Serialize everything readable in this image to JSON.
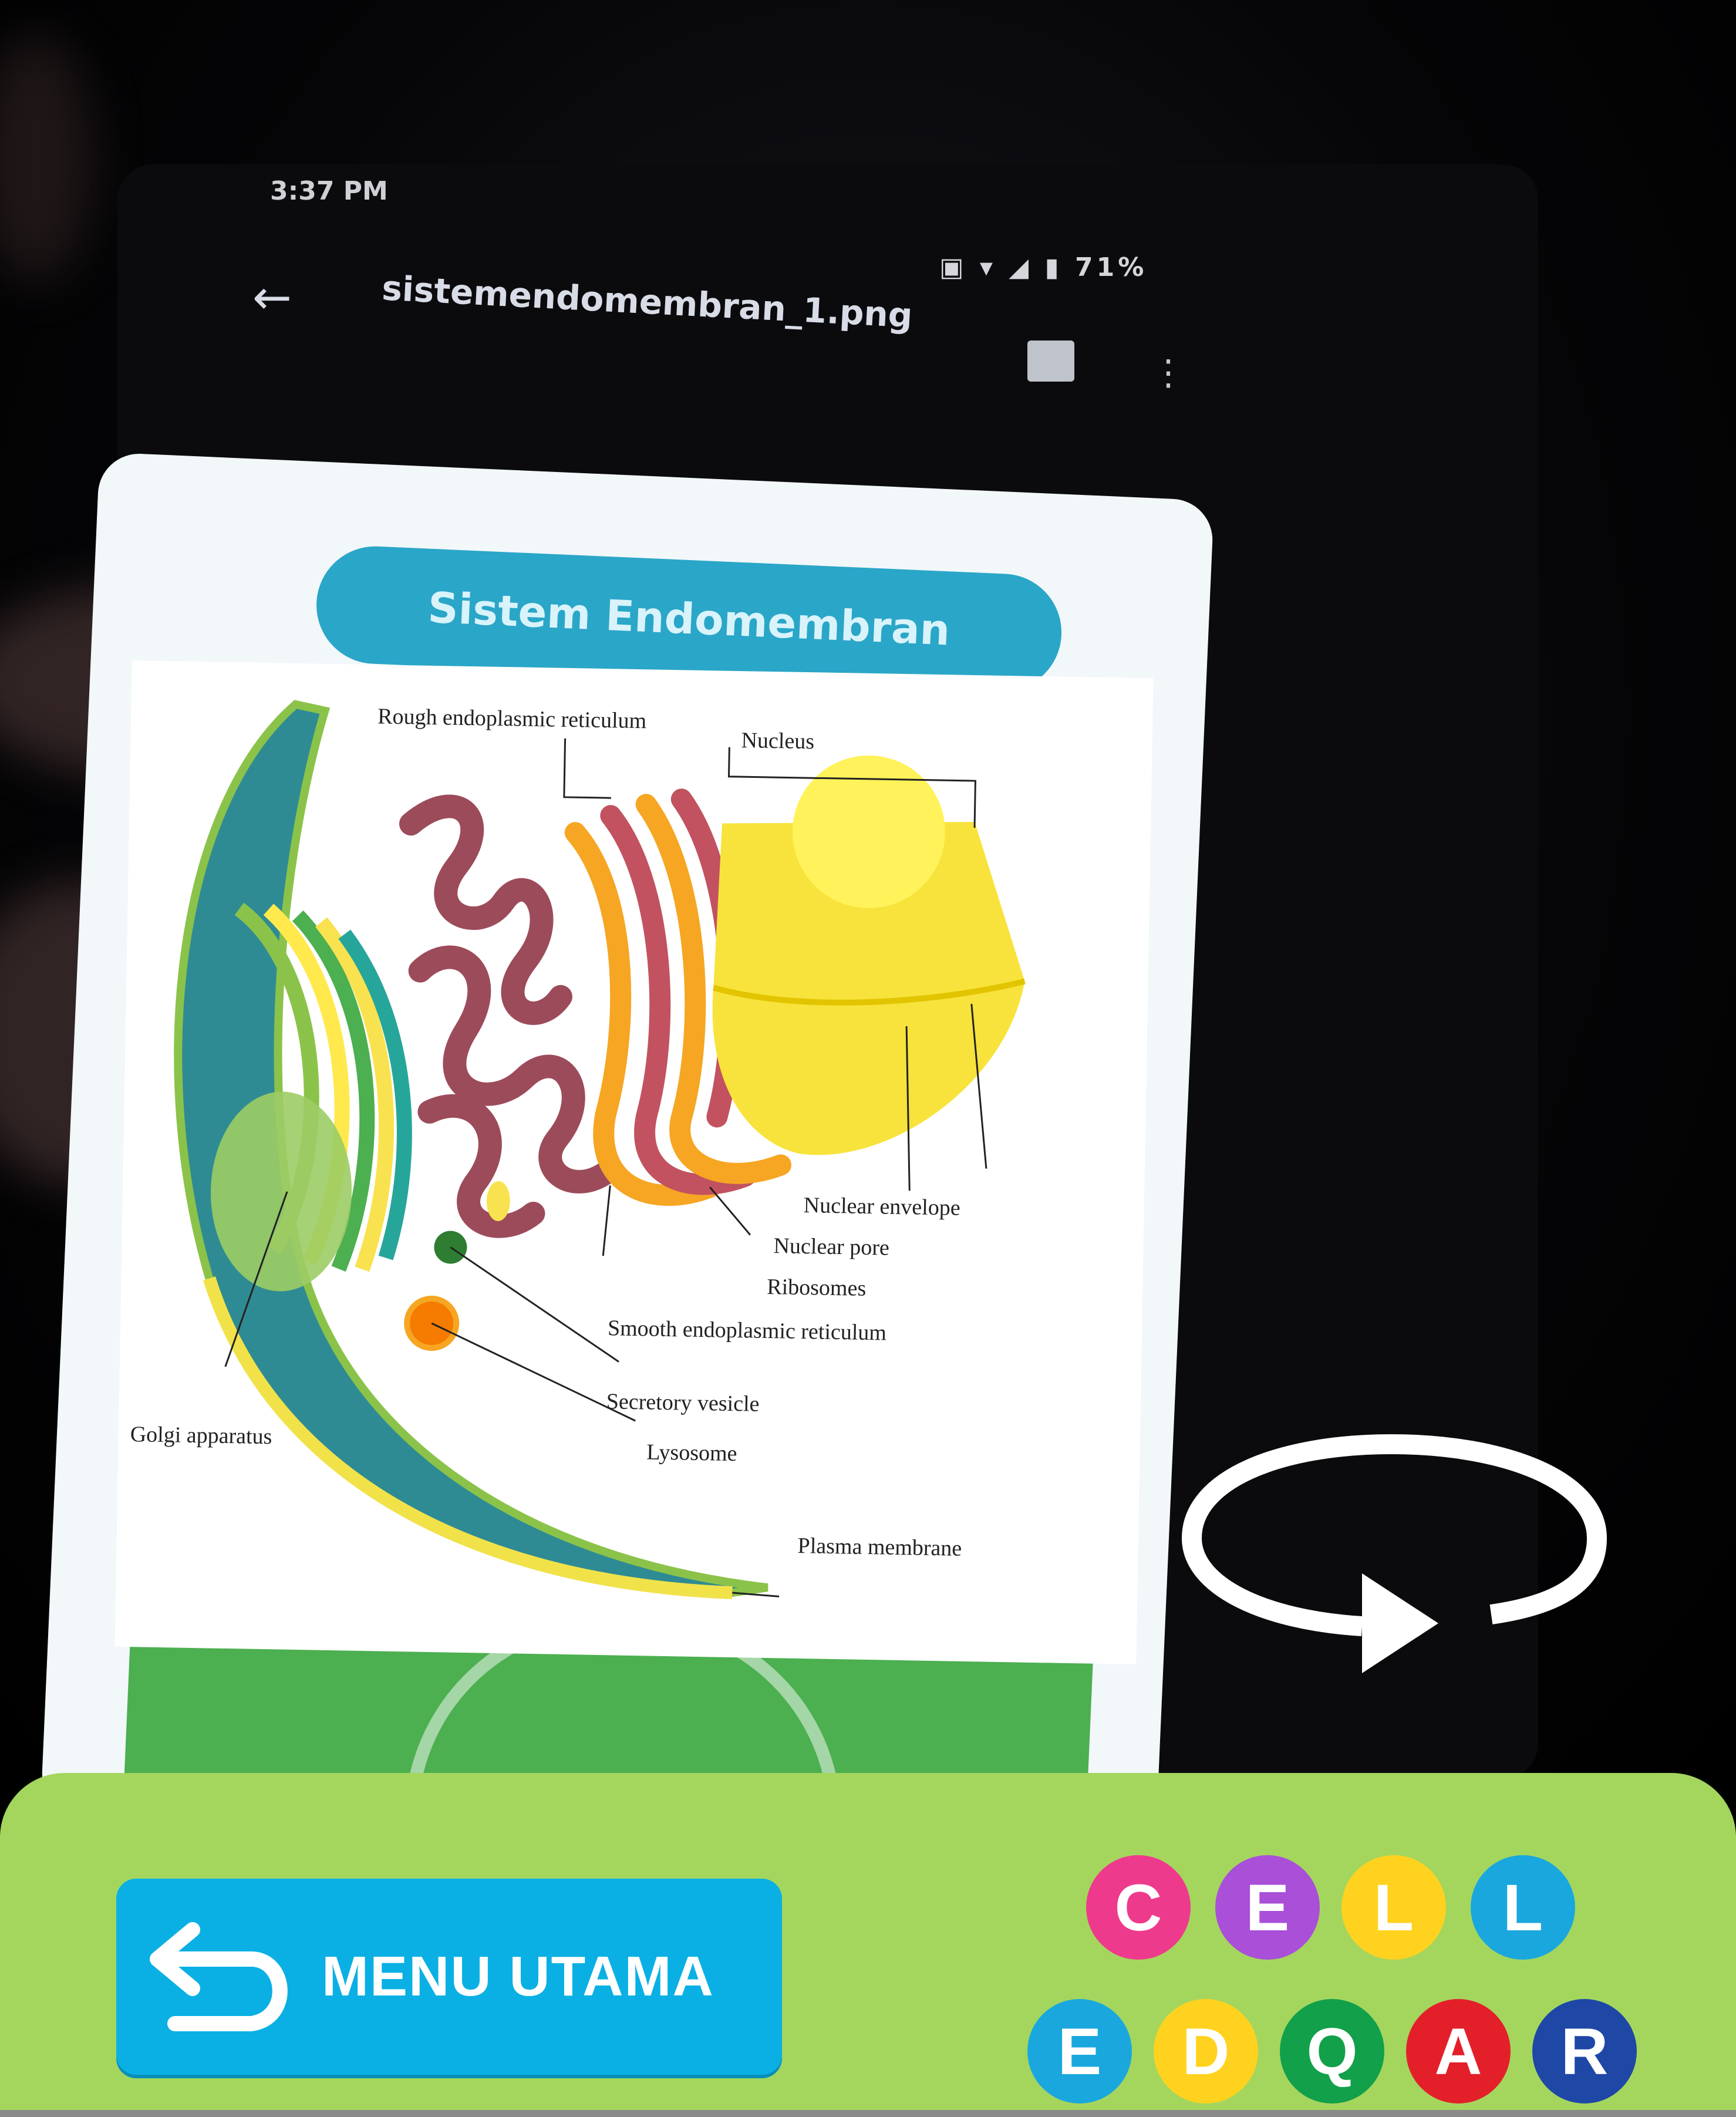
{
  "app": {
    "status_time": "3:37 PM",
    "status_right": "▣ ▾ ◢ ▮ 71%",
    "file_title": "sistemendomembran_1.png",
    "screen_title": "Sistem Endomembran"
  },
  "diagram": {
    "labels": {
      "rough_er": "Rough endoplasmic reticulum",
      "nucleus": "Nucleus",
      "nuclear_envelope": "Nuclear envelope",
      "nuclear_pore": "Nuclear pore",
      "ribosomes": "Ribosomes",
      "smooth_er": "Smooth endoplasmic reticulum",
      "secretory_vesicle": "Secretory vesicle",
      "lysosome": "Lysosome",
      "plasma_membrane": "Plasma membrane",
      "golgi": "Golgi apparatus"
    }
  },
  "controls": {
    "rotate_icon": "rotate-icon",
    "menu_button_label": "MENU UTAMA",
    "menu_icon": "return-arrow-icon"
  },
  "logo": {
    "row1": [
      {
        "letter": "C",
        "color": "#ee3a8c"
      },
      {
        "letter": "E",
        "color": "#a94fd8"
      },
      {
        "letter": "L",
        "color": "#ffd21f"
      },
      {
        "letter": "L",
        "color": "#1aa7de"
      }
    ],
    "row2": [
      {
        "letter": "E",
        "color": "#1aa7de"
      },
      {
        "letter": "D",
        "color": "#ffd21f"
      },
      {
        "letter": "Q",
        "color": "#12a04a"
      },
      {
        "letter": "A",
        "color": "#e3202a"
      },
      {
        "letter": "R",
        "color": "#1e47a6"
      }
    ]
  },
  "colors": {
    "bottom_bar": "#a4d65e",
    "menu_button": "#0ab0e3",
    "screen_title_bg": "#2aa6c8"
  }
}
